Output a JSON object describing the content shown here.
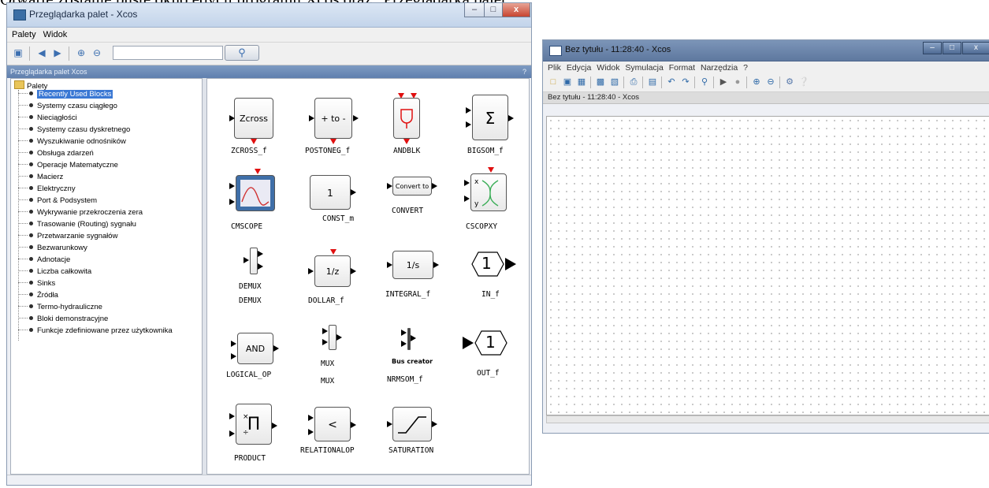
{
  "caption": "Otwarte zostanie puste okno edycji programu Xcos oraz „Przeglądarka palet”",
  "palette_window": {
    "title": "Przeglądarka palet - Xcos",
    "menu": [
      "Palety",
      "Widok"
    ],
    "search_value": "",
    "subheader": "Przeglądarka palet  Xcos",
    "help": "?",
    "controls": {
      "minimize": "–",
      "maximize": "□",
      "close": "x"
    },
    "tree": {
      "root": "Palety",
      "items": [
        "Recently Used Blocks",
        "Systemy czasu ciągłego",
        "Nieciągłości",
        "Systemy czasu dyskretnego",
        "Wyszukiwanie odnośników",
        "Obsługa zdarzeń",
        "Operacje Matematyczne",
        "Macierz",
        "Elektryczny",
        "Port & Podsystem",
        "Wykrywanie przekroczenia zera",
        "Trasowanie (Routing) sygnału",
        "Przetwarzanie sygnałów",
        "Bezwarunkowy",
        "Adnotacje",
        "Liczba całkowita",
        "Sinks",
        "Źródła",
        "Termo-hydrauliczne",
        "Bloki demonstracyjne",
        "Funkcje zdefiniowane przez użytkownika"
      ],
      "selected_index": 0
    },
    "blocks": [
      {
        "name": "ZCROSS_f",
        "glyph": "Zcross"
      },
      {
        "name": "POSTONEG_f",
        "glyph": "+ to -"
      },
      {
        "name": "ANDBLK",
        "glyph": ""
      },
      {
        "name": "BIGSOM_f",
        "glyph": "Σ"
      },
      {
        "name": "CMSCOPE",
        "glyph": ""
      },
      {
        "name": "CONST_m",
        "glyph": "1"
      },
      {
        "name": "CONVERT",
        "glyph": "Convert to"
      },
      {
        "name": "CSCOPXY",
        "glyph": ""
      },
      {
        "name": "DEMUX",
        "glyph": "",
        "inner": "DEMUX"
      },
      {
        "name": "DOLLAR_f",
        "glyph": "1/z"
      },
      {
        "name": "INTEGRAL_f",
        "glyph": "1/s"
      },
      {
        "name": "IN_f",
        "glyph": "1"
      },
      {
        "name": "LOGICAL_OP",
        "glyph": "AND"
      },
      {
        "name": "MUX",
        "glyph": "",
        "inner": "MUX"
      },
      {
        "name": "NRMSOM_f",
        "glyph": "",
        "inner": "Bus creator"
      },
      {
        "name": "OUT_f",
        "glyph": "1"
      },
      {
        "name": "PRODUCT",
        "glyph": "Π"
      },
      {
        "name": "RELATIONALOP",
        "glyph": "<"
      },
      {
        "name": "SATURATION",
        "glyph": ""
      }
    ]
  },
  "xcos_window": {
    "title": "Bez tytułu - 11:28:40 - Xcos",
    "menu": [
      "Plik",
      "Edycja",
      "Widok",
      "Symulacja",
      "Format",
      "Narzędzia",
      "?"
    ],
    "doc_title": "Bez tytułu - 11:28:40 - Xcos",
    "controls": {
      "minimize": "–",
      "maximize": "□",
      "close": "x"
    }
  },
  "icons": {
    "open_folder": "folder-open-icon",
    "back": "arrow-left-icon",
    "forward": "arrow-right-icon",
    "zoom_in": "zoom-in-icon",
    "zoom_out": "zoom-out-icon",
    "search": "magnifier-icon"
  },
  "colors": {
    "selection": "#3a78d4",
    "event_port": "#e01010",
    "title_active": "#5e789f"
  }
}
